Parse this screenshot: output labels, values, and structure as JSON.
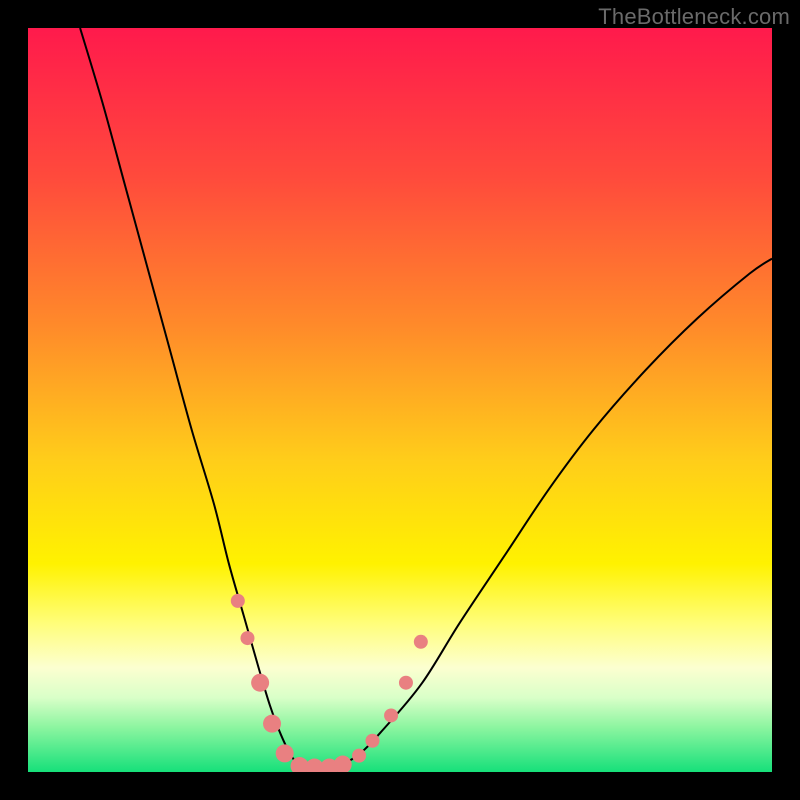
{
  "watermark": {
    "text": "TheBottleneck.com"
  },
  "chart_data": {
    "type": "line",
    "title": "",
    "xlabel": "",
    "ylabel": "",
    "xlim": [
      0,
      100
    ],
    "ylim": [
      0,
      100
    ],
    "grid": false,
    "legend": false,
    "background": {
      "type": "vertical-gradient",
      "stops": [
        {
          "pos": 0.0,
          "color": "#ff1a4c"
        },
        {
          "pos": 0.2,
          "color": "#ff4a3c"
        },
        {
          "pos": 0.4,
          "color": "#ff8a2a"
        },
        {
          "pos": 0.58,
          "color": "#ffcd1a"
        },
        {
          "pos": 0.72,
          "color": "#fff200"
        },
        {
          "pos": 0.8,
          "color": "#fffe7a"
        },
        {
          "pos": 0.86,
          "color": "#fcffd0"
        },
        {
          "pos": 0.9,
          "color": "#d9ffc8"
        },
        {
          "pos": 0.94,
          "color": "#8cf5a0"
        },
        {
          "pos": 1.0,
          "color": "#16e07a"
        }
      ]
    },
    "series": [
      {
        "name": "bottleneck-curve",
        "color": "#000000",
        "width": 2,
        "x": [
          7,
          10,
          13,
          16,
          19,
          22,
          25,
          27,
          29,
          31,
          32.5,
          34,
          35.5,
          37,
          40,
          44,
          48,
          53,
          58,
          64,
          70,
          76,
          83,
          90,
          97,
          100
        ],
        "y": [
          100,
          90,
          79,
          68,
          57,
          46,
          36,
          28,
          21,
          14,
          9,
          5,
          2,
          0.5,
          0.5,
          2,
          6,
          12,
          20,
          29,
          38,
          46,
          54,
          61,
          67,
          69
        ]
      }
    ],
    "markers": {
      "color": "#e98081",
      "radius_small": 7,
      "radius_large": 9,
      "points": [
        {
          "x": 28.2,
          "y": 23.0,
          "r": 7
        },
        {
          "x": 29.5,
          "y": 18.0,
          "r": 7
        },
        {
          "x": 31.2,
          "y": 12.0,
          "r": 9
        },
        {
          "x": 32.8,
          "y": 6.5,
          "r": 9
        },
        {
          "x": 34.5,
          "y": 2.5,
          "r": 9
        },
        {
          "x": 36.5,
          "y": 0.8,
          "r": 9
        },
        {
          "x": 38.5,
          "y": 0.6,
          "r": 9
        },
        {
          "x": 40.5,
          "y": 0.6,
          "r": 9
        },
        {
          "x": 42.3,
          "y": 1.0,
          "r": 9
        },
        {
          "x": 44.5,
          "y": 2.2,
          "r": 7
        },
        {
          "x": 46.3,
          "y": 4.2,
          "r": 7
        },
        {
          "x": 48.8,
          "y": 7.6,
          "r": 7
        },
        {
          "x": 50.8,
          "y": 12.0,
          "r": 7
        },
        {
          "x": 52.8,
          "y": 17.5,
          "r": 7
        }
      ]
    }
  }
}
